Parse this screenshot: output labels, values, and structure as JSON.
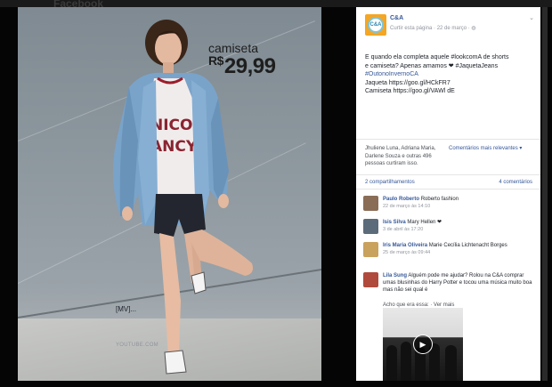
{
  "window": {
    "header_text": "Facebook"
  },
  "photo": {
    "price_label": "camiseta",
    "price_currency": "R$",
    "price_value": "29,99",
    "shirt_text": "NICO ANCY"
  },
  "post": {
    "page_name": "C&A",
    "page_initials": "C&A",
    "meta": "Curtir esta página · 22 de março · ",
    "body_lines": [
      "E quando ela completa aquele #lookcomA de shorts",
      "e camiseta? Apenas amamos ❤ #JaquetaJeans",
      "#OutonoInvernoCA",
      "Jaqueta https://goo.gl/HCkFR7",
      "Camiseta https://goo.gl/VAWl dE"
    ],
    "reactions_text": "Jhuliene Luna, Adriana Maria, Darlene Souza e outras 496 pessoas curtiram isso.",
    "relevance_label": "Comentários mais relevantes ▾",
    "shares": "2 compartilhamentos",
    "comments_count": "4 comentários"
  },
  "comments": [
    {
      "name": "Paulo Roberto",
      "text": "Roberto fashion",
      "date": "22 de março às 14:10",
      "avatar_color": "#8a6d56"
    },
    {
      "name": "Isis Silva",
      "text": "Mary Hellen ❤",
      "date": "3 de abril às 17:20",
      "avatar_color": "#5c6b7a"
    },
    {
      "name": "Iris Maria Oliveira",
      "text": "Marie Cecília Lichtenacht Borges",
      "date": "25 de março às 09:44",
      "avatar_color": "#c9a25e"
    },
    {
      "name": "Lila Sung",
      "text": "Alguém pode me ajudar? Rolou na C&A comprar umas blusinhas do Harry Potter e tocou uma música muito boa mas não sei qual é",
      "date": "",
      "avatar_color": "#b04a3c"
    }
  ],
  "reply_line": "Acho que era essa: · Ver mais",
  "preview": {
    "title": "[MV]...",
    "source": "YOUTUBE.COM"
  }
}
